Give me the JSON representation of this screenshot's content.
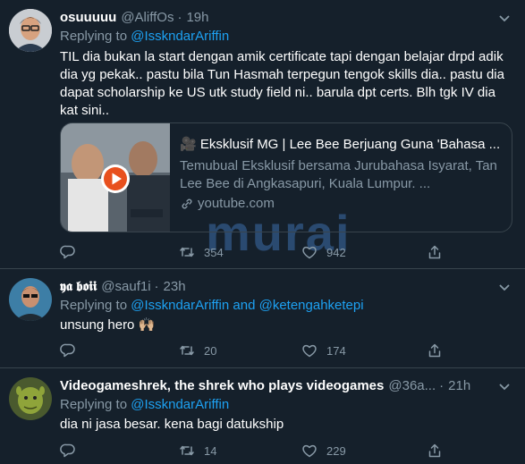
{
  "tweets": [
    {
      "name": "osuuuuu",
      "handle": "@AliffOs",
      "time": "19h",
      "reply_prefix": "Replying to ",
      "reply_to": "@IsskndarAriffin",
      "text": "TIL dia bukan la start dengan amik certificate tapi dengan belajar drpd adik dia yg pekak..  pastu bila Tun Hasmah terpegun tengok skills dia.. pastu dia dapat scholarship ke US utk study field ni.. barula dpt certs. Blh tgk IV dia kat sini..",
      "card": {
        "title": "🎥 Eksklusif MG | Lee Bee Berjuang Guna 'Bahasa ...",
        "description": "Temubual Eksklusif bersama Jurubahasa Isyarat, Tan Lee Bee di Angkasapuri, Kuala Lumpur. ...",
        "url": "youtube.com"
      },
      "retweets": "354",
      "likes": "942"
    },
    {
      "name": "𝖞𝖆 𝖇𝖔𝖎𝖎",
      "handle": "@sauf1i",
      "time": "23h",
      "reply_prefix": "Replying to ",
      "reply_to": "@IsskndarAriffin",
      "reply_and": " and ",
      "reply_to_2": "@ketengahketepi",
      "text": "unsung hero 🙌🏼",
      "retweets": "20",
      "likes": "174"
    },
    {
      "name": "Videogameshrek, the shrek who plays videogames",
      "handle": "@36a...",
      "time": "21h",
      "reply_prefix": "Replying to ",
      "reply_to": "@IsskndarAriffin",
      "text": "dia ni jasa besar. kena bagi datukship",
      "retweets": "14",
      "likes": "229"
    }
  ],
  "watermark": "murai",
  "colors": {
    "background": "#15202b",
    "accent": "#1da1f2",
    "muted": "#8899a6",
    "border": "#38444d",
    "play_button": "#e8501e"
  },
  "icons": [
    "reply-icon",
    "retweet-icon",
    "like-icon",
    "share-icon",
    "chevron-down-icon",
    "link-icon",
    "play-icon"
  ]
}
